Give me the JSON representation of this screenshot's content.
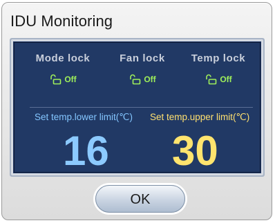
{
  "dialog": {
    "title": "IDU Monitoring"
  },
  "locks": [
    {
      "title": "Mode lock",
      "state": "Off",
      "icon": "unlocked-padlock-icon"
    },
    {
      "title": "Fan lock",
      "state": "Off",
      "icon": "unlocked-padlock-icon"
    },
    {
      "title": "Temp lock",
      "state": "Off",
      "icon": "unlocked-padlock-icon"
    }
  ],
  "limits": {
    "lower": {
      "label": "Set temp.lower limit(℃)",
      "value": "16",
      "color": "#8ccaff"
    },
    "upper": {
      "label": "Set temp.upper limit(℃)",
      "value": "30",
      "color": "#ffe46e"
    }
  },
  "actions": {
    "ok_label": "OK"
  },
  "colors": {
    "panel": "#213965",
    "lock_state": "#9ff05a"
  }
}
